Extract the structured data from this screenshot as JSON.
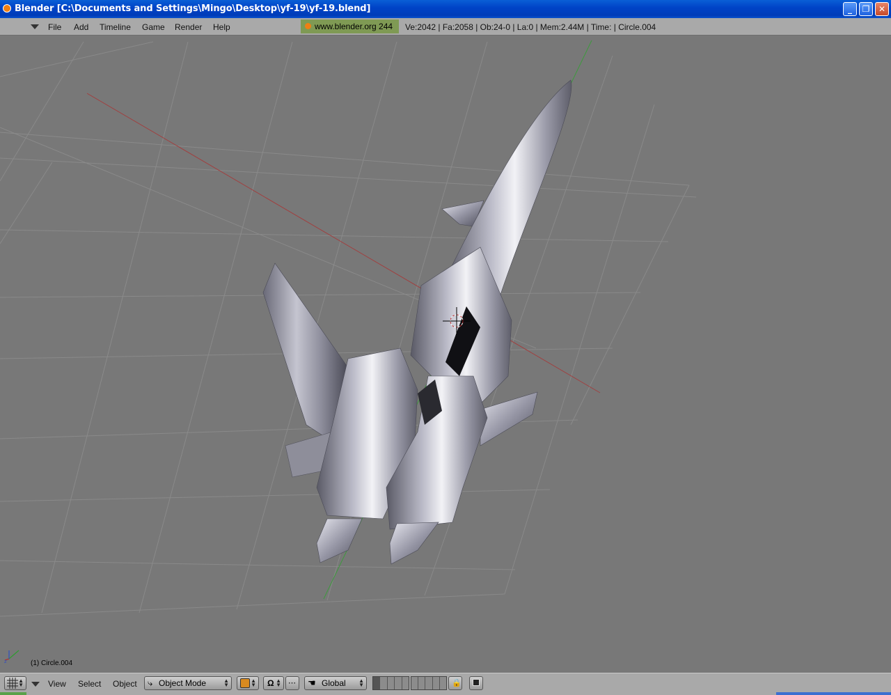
{
  "window": {
    "title": "Blender [C:\\Documents and Settings\\Mingo\\Desktop\\yf-19\\yf-19.blend]",
    "min_glyph": "_",
    "restore_glyph": "❐",
    "close_glyph": "✕"
  },
  "menubar": {
    "items": [
      "File",
      "Add",
      "Timeline",
      "Game",
      "Render",
      "Help"
    ],
    "weblink": "www.blender.org 244",
    "stats": "Ve:2042 | Fa:2058 | Ob:24-0 | La:0  | Mem:2.44M  | Time: | Circle.004"
  },
  "viewport": {
    "object_label": "(1) Circle.004",
    "background_color": "#787878",
    "grid_color": "#8a8a8a",
    "x_axis_color": "#a04040",
    "y_axis_color": "#3d9a3d",
    "cursor_color": "#c03030",
    "model_name": "yf-19 jet fighter"
  },
  "bottombar": {
    "view_label": "View",
    "select_label": "Select",
    "object_label": "Object",
    "mode_label": "Object Mode",
    "orientation_label": "Global",
    "icons": [
      "grid-icon",
      "shading-icon",
      "pivot-icon",
      "snap-icon",
      "hand-icon",
      "lock-icon",
      "render-icon"
    ]
  }
}
